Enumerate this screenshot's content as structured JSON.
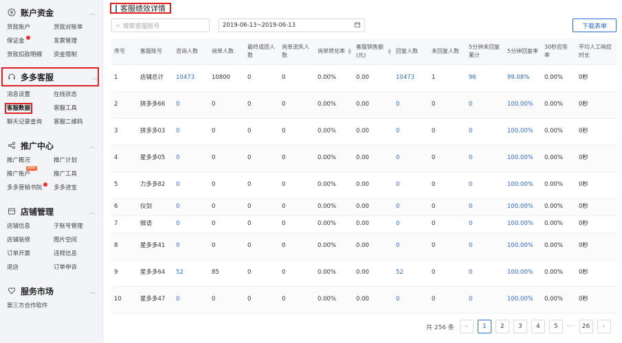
{
  "sidebar": {
    "sections": [
      {
        "title": "账户资金",
        "icon": "yen-icon",
        "items": [
          "货款账户",
          "货款对账单",
          "保证金",
          "发票管理",
          "货款扣款明细",
          "资金限制"
        ],
        "dot_on": "保证金"
      },
      {
        "title": "多多客服",
        "icon": "headset-icon",
        "items": [
          "消息设置",
          "在线状态",
          "客服数据",
          "客服工具",
          "聊天记录查询",
          "客服二维码"
        ],
        "active": "客服数据"
      },
      {
        "title": "推广中心",
        "icon": "share-icon",
        "items": [
          "推广概况",
          "推广计划",
          "推广账户",
          "推广工具",
          "多多营销书院",
          "多多进宝"
        ],
        "badge_on": "推广账户",
        "badge_text": "NEW",
        "dot_on": "多多营销书院"
      },
      {
        "title": "店铺管理",
        "icon": "store-icon",
        "items": [
          "店铺信息",
          "子账号管理",
          "店铺装修",
          "图片空间",
          "订单开票",
          "违规信息",
          "退店",
          "订单申诉"
        ]
      },
      {
        "title": "服务市场",
        "icon": "heart-icon",
        "items": [
          "第三方合作软件"
        ]
      }
    ]
  },
  "main": {
    "title": "客服绩效详情",
    "search_placeholder": "搜索客服账号",
    "date_range": "2019-06-13~2019-06-13",
    "download_label": "下载表单",
    "table": {
      "headers": [
        "序号",
        "客服账号",
        "咨询人数",
        "询单人数",
        "最终成团人数",
        "询单流失人数",
        "询单转化率",
        "客服销售额(元)",
        "回复人数",
        "未回复人数",
        "5分钟未回复累计",
        "5分钟回复率",
        "30秒应答率",
        "平均人工响应时长"
      ],
      "rows": [
        [
          "1",
          "店铺总计",
          "10473",
          "10800",
          "0",
          "0",
          "0.00%",
          "0.00",
          "10473",
          "1",
          "96",
          "99.08%",
          "0.00%",
          "0秒"
        ],
        [
          "2",
          "拼多多66",
          "0",
          "0",
          "0",
          "0",
          "0.00%",
          "0.00",
          "0",
          "0",
          "0",
          "100.00%",
          "0.00%",
          "0秒"
        ],
        [
          "3",
          "拼多多03",
          "0",
          "0",
          "0",
          "0",
          "0.00%",
          "0.00",
          "0",
          "0",
          "0",
          "100.00%",
          "0.00%",
          "0秒"
        ],
        [
          "4",
          "星多多05",
          "0",
          "0",
          "0",
          "0",
          "0.00%",
          "0.00",
          "0",
          "0",
          "0",
          "100.00%",
          "0.00%",
          "0秒"
        ],
        [
          "5",
          "力多多82",
          "0",
          "0",
          "0",
          "0",
          "0.00%",
          "0.00",
          "0",
          "0",
          "0",
          "100.00%",
          "0.00%",
          "0秒"
        ],
        [
          "6",
          "仪剑",
          "0",
          "0",
          "0",
          "0",
          "0.00%",
          "0.00",
          "0",
          "0",
          "0",
          "100.00%",
          "0.00%",
          "0秒"
        ],
        [
          "7",
          "微语",
          "0",
          "0",
          "0",
          "0",
          "0.00%",
          "0.00",
          "0",
          "0",
          "0",
          "100.00%",
          "0.00%",
          "0秒"
        ],
        [
          "8",
          "星多多41",
          "0",
          "0",
          "0",
          "0",
          "0.00%",
          "0.00",
          "0",
          "0",
          "0",
          "100.00%",
          "0.00%",
          "0秒"
        ],
        [
          "9",
          "星多多64",
          "52",
          "85",
          "0",
          "0",
          "0.00%",
          "0.00",
          "52",
          "0",
          "0",
          "100.00%",
          "0.00%",
          "0秒"
        ],
        [
          "10",
          "星多多47",
          "0",
          "0",
          "0",
          "0",
          "0.00%",
          "0.00",
          "0",
          "0",
          "0",
          "100.00%",
          "0.00%",
          "0秒"
        ]
      ]
    },
    "pagination": {
      "total_text": "共 256 条",
      "pages": [
        "1",
        "2",
        "3",
        "4",
        "5"
      ],
      "ellipsis": "···",
      "last_page": "26",
      "current": "1"
    }
  },
  "colors": {
    "accent": "#2b6be0",
    "highlight_box": "#e02020",
    "dot": "#e5322d"
  }
}
